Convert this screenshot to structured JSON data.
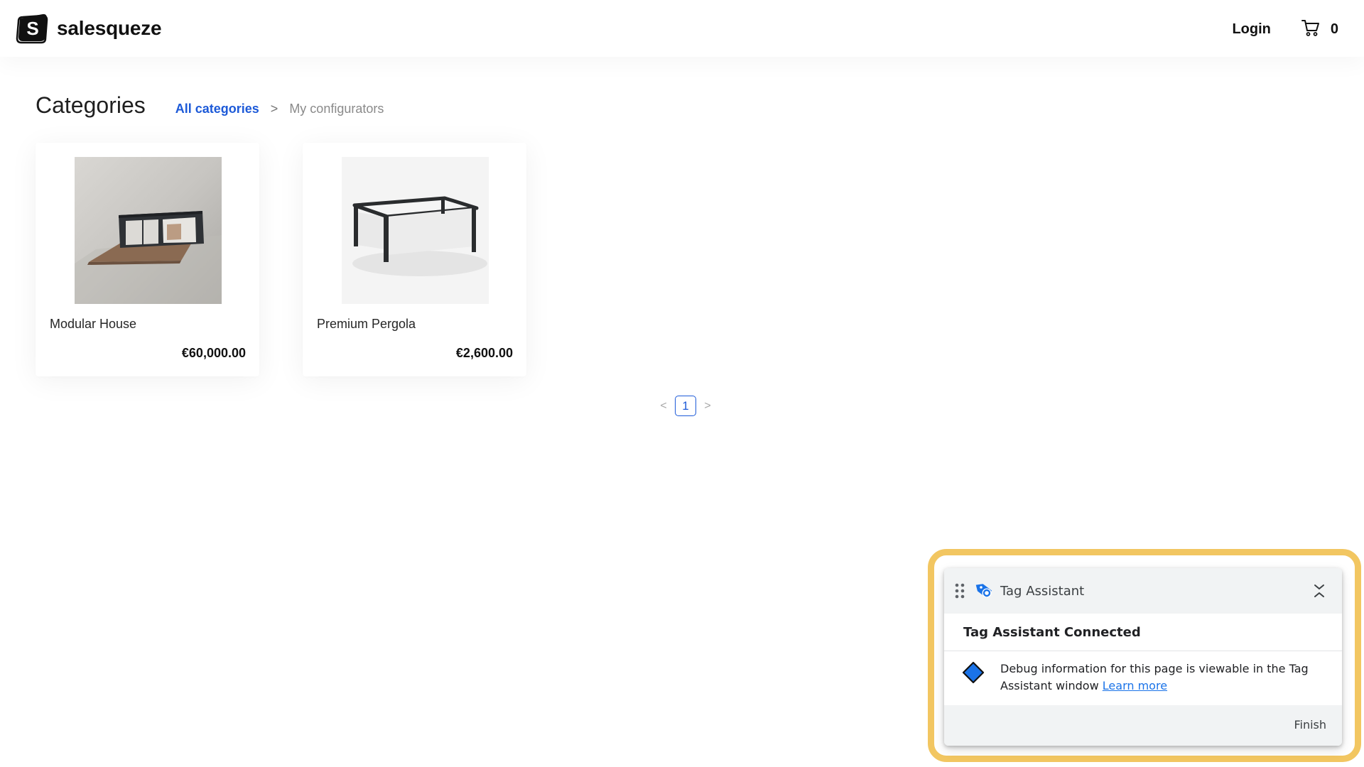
{
  "header": {
    "brand": "salesqueze",
    "logo_letter": "S",
    "login_label": "Login",
    "cart_count": "0"
  },
  "page": {
    "title": "Categories"
  },
  "breadcrumb": {
    "root": "All categories",
    "separator": ">",
    "current": "My configurators"
  },
  "products": [
    {
      "name": "Modular House",
      "price": "€60,000.00"
    },
    {
      "name": "Premium Pergola",
      "price": "€2,600.00"
    }
  ],
  "pagination": {
    "prev": "<",
    "current": "1",
    "next": ">"
  },
  "tag_assistant": {
    "title": "Tag Assistant",
    "status": "Tag Assistant Connected",
    "message": "Debug information for this page is viewable in the Tag Assistant window",
    "learn_more": "Learn more",
    "finish_label": "Finish"
  },
  "colors": {
    "accent_blue": "#1d5ad8",
    "highlight_yellow": "#f2c661",
    "tag_blue": "#1a73e8"
  }
}
